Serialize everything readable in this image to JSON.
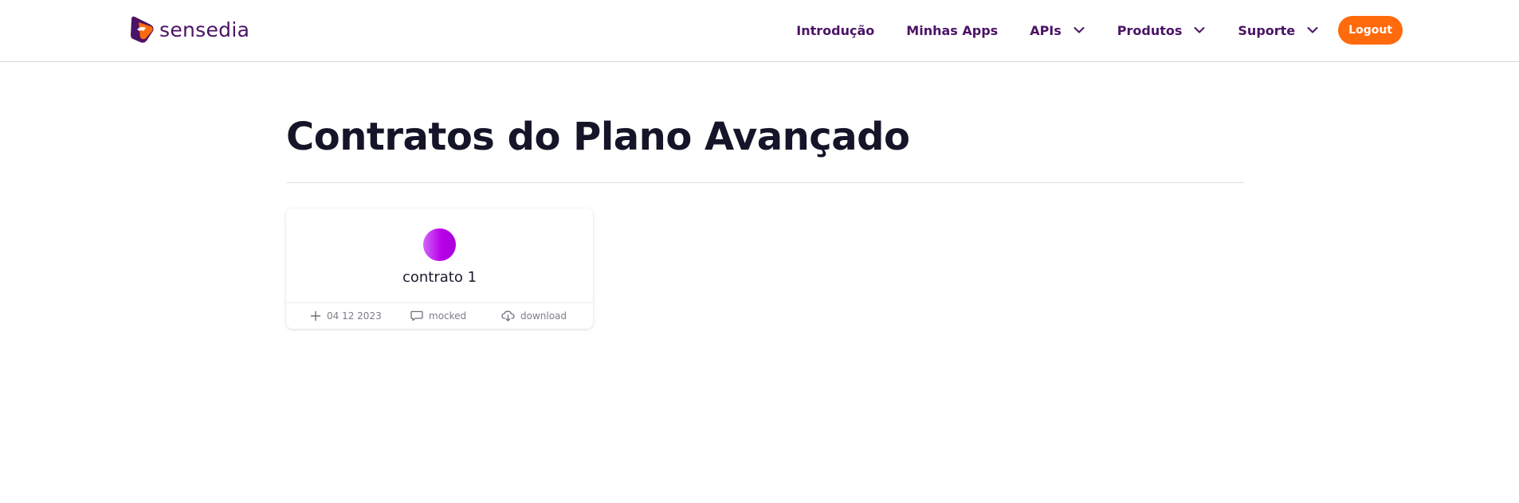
{
  "header": {
    "logo_text": "sensedia",
    "nav": [
      {
        "label": "Introdução"
      },
      {
        "label": "Minhas Apps"
      },
      {
        "label": "APIs"
      },
      {
        "label": "Produtos"
      },
      {
        "label": "Suporte"
      }
    ],
    "logout_label": "Logout"
  },
  "main": {
    "title": "Contratos do Plano Avançado",
    "cards": [
      {
        "title": "contrato 1",
        "date": "04 12 2023",
        "type": "mocked",
        "action": "download"
      }
    ]
  },
  "colors": {
    "brand": "#4b1366",
    "accent": "#ff6a0d",
    "avatar_gradient": [
      "#d166f7",
      "#a800dc"
    ]
  },
  "icons": [
    "sensedia-logo",
    "chevron-down-icon",
    "plus-icon",
    "comment-icon",
    "cloud-download-icon"
  ]
}
